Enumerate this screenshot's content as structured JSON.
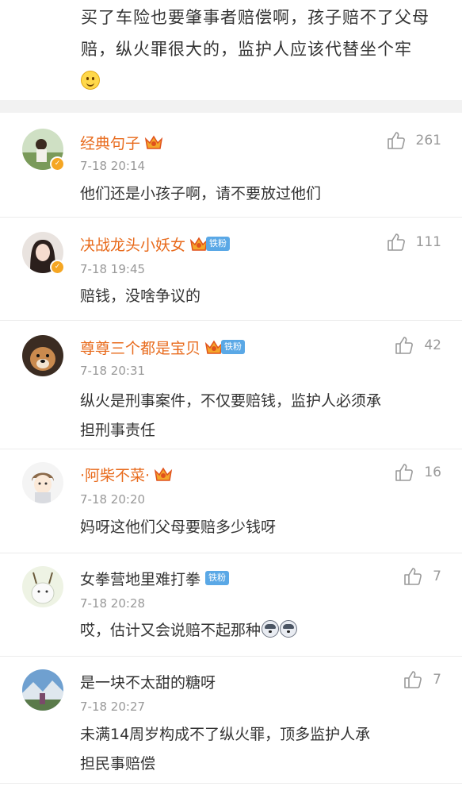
{
  "post": {
    "text": "买了车险也要肇事者赔偿啊，孩子赔不了父母赔，纵火罪很大的，监护人应该代替坐个牢",
    "emoji": "smile-emoji"
  },
  "comments": [
    {
      "user": "经典句子",
      "crown": true,
      "fan_badge": "",
      "time": "7-18 20:14",
      "likes": "261",
      "text": "他们还是小孩子啊，请不要放过他们",
      "text2": ""
    },
    {
      "user": "决战龙头小妖女",
      "crown": true,
      "fan_badge": "铁粉",
      "time": "7-18 19:45",
      "likes": "111",
      "text": "赔钱，没啥争议的",
      "text2": ""
    },
    {
      "user": "尊尊三个都是宝贝",
      "crown": true,
      "fan_badge": "铁粉",
      "time": "7-18 20:31",
      "likes": "42",
      "text": "纵火是刑事案件，不仅要赔钱，监护人必须承",
      "text2": "担刑事责任"
    },
    {
      "user": "·阿柴不菜·",
      "crown": true,
      "fan_badge": "",
      "time": "7-18 20:20",
      "likes": "16",
      "text": "妈呀这他们父母要赔多少钱呀",
      "text2": ""
    },
    {
      "user": "女拳营地里难打拳",
      "crown": false,
      "fan_badge": "铁粉",
      "time": "7-18 20:28",
      "likes": "7",
      "text": "哎，估计又会说赔不起那种",
      "text2": ""
    },
    {
      "user": "是一块不太甜的糖呀",
      "crown": false,
      "fan_badge": "",
      "time": "7-18 20:27",
      "likes": "7",
      "text": "未满14周岁构成不了纵火罪，顶多监护人承",
      "text2": "担民事赔偿"
    }
  ],
  "colors": {
    "vip_name": "#e86b1d",
    "fan_badge": "#5aa8e6",
    "muted": "#999999"
  }
}
